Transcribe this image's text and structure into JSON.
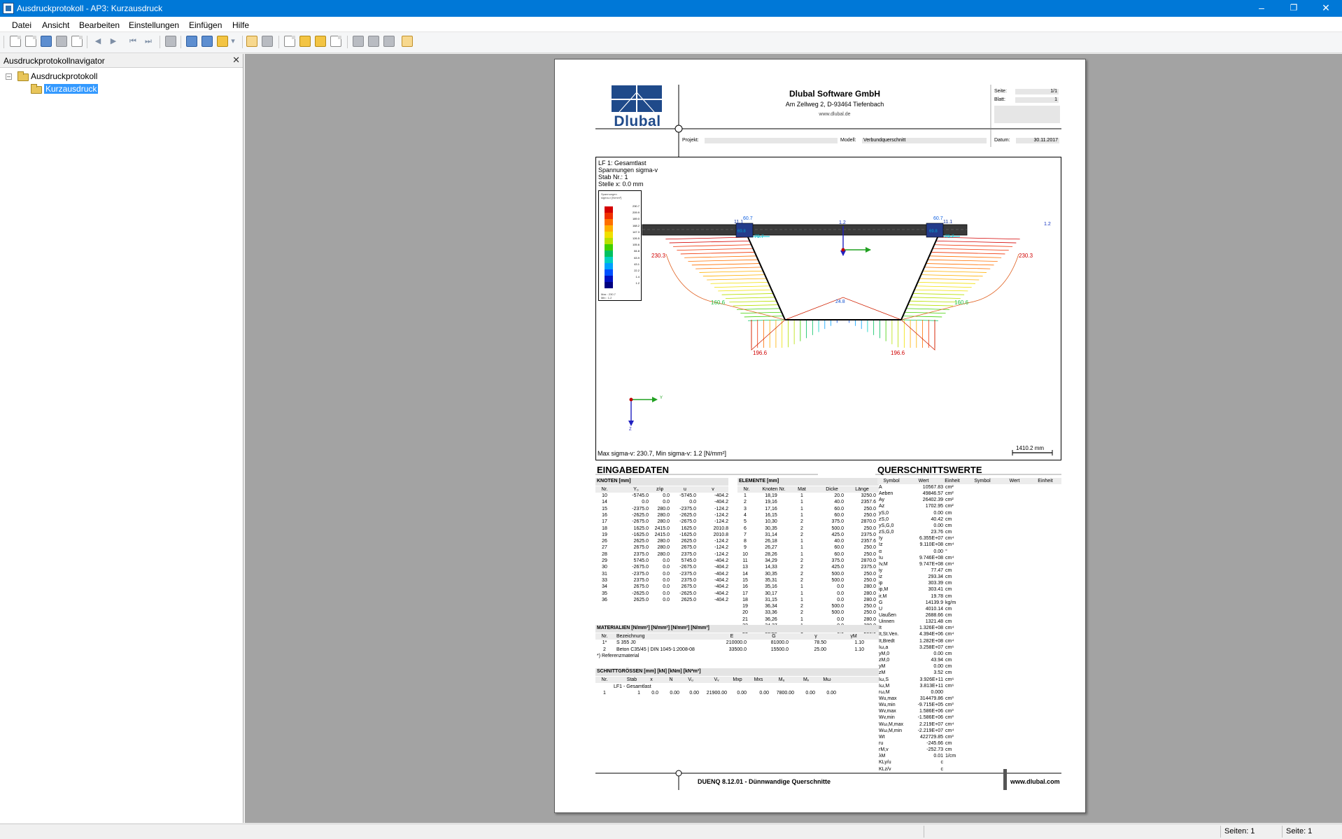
{
  "window": {
    "title": "Ausdruckprotokoll - AP3: Kurzausdruck"
  },
  "menu": [
    "Datei",
    "Ansicht",
    "Bearbeiten",
    "Einstellungen",
    "Einfügen",
    "Hilfe"
  ],
  "navigator": {
    "title": "Ausdruckprotokollnavigator",
    "root": "Ausdruckprotokoll",
    "child": "Kurzausdruck"
  },
  "status": {
    "pages_left": "Seiten: 1",
    "page_right": "Seite: 1"
  },
  "report": {
    "company": "Dlubal Software GmbH",
    "address": "Am Zellweg 2, D-93464 Tiefenbach",
    "web": "www.dlubal.de",
    "logo": "Dlubal",
    "seite_label": "Seite:",
    "seite_value": "1/1",
    "blatt_label": "Blatt:",
    "blatt_value": "1",
    "projekt_label": "Projekt:",
    "modell_label": "Modell:",
    "modell_value": "Verbundquerschnitt",
    "datum_label": "Datum:",
    "datum_value": "30.11.2017",
    "footer_program": "DUENQ 8.12.01 - Dünnwandige Querschnitte",
    "footer_web": "www.dlubal.com"
  },
  "graphic": {
    "info_lines": [
      "LF 1: Gesamtlast",
      "Spannungen sigma-v",
      "Stab Nr.: 1",
      "Stelle x: 0.0 mm"
    ],
    "legend_title": "Spannungen",
    "legend_unit": "sigma-v [N/mm²]",
    "legend_values": [
      "230.7",
      "209.9",
      "189.0",
      "168.2",
      "147.3",
      "126.5",
      "105.6",
      "84.8",
      "63.9",
      "43.1",
      "22.2",
      "1.4",
      "1.2"
    ],
    "legend_colors": [
      "#d40000",
      "#f03000",
      "#ff7000",
      "#ffb000",
      "#f0e000",
      "#b8e000",
      "#40d000",
      "#00c060",
      "#00d0c0",
      "#00a0ff",
      "#0050ff",
      "#0010c0",
      "#000080"
    ],
    "legend_max": "Max : 230.7",
    "legend_min": "Min :   1.2",
    "labels": {
      "wall_left_top": "230.3",
      "wall_right_top": "230.3",
      "wall_left_mid": "160.6",
      "wall_right_mid": "160.6",
      "bottom_center": "24.8",
      "bottom_left": "196.6",
      "bottom_right": "196.6",
      "flange_left_a": "60.7",
      "flange_left_b": "11.1",
      "flange_left_c": "79.7",
      "flange_left_d": "69.8",
      "flange_right_a": "60.7",
      "flange_right_b": "11.1",
      "flange_right_c": "79.7",
      "flange_right_d": "69.8",
      "deck_center": "1.2",
      "deck_right": "1.2"
    },
    "axis_y": "Y",
    "axis_z": "Z",
    "caption": "Max sigma-v: 230.7, Min sigma-v: 1.2 [N/mm²]",
    "scale_label": "1410.2 mm"
  },
  "eingabe": {
    "title": "EINGABEDATEN",
    "knoten_title": "KNOTEN [mm]",
    "knoten_cols": [
      "Nr.",
      "Y₀",
      "z/φ",
      "u",
      "v"
    ],
    "knoten_rows": [
      [
        "10",
        "-5745.0",
        "0.0",
        "-5745.0",
        "-404.2"
      ],
      [
        "14",
        "0.0",
        "0.0",
        "0.0",
        "-404.2"
      ],
      [
        "15",
        "-2375.0",
        "280.0",
        "-2375.0",
        "-124.2"
      ],
      [
        "16",
        "-2625.0",
        "280.0",
        "-2625.0",
        "-124.2"
      ],
      [
        "17",
        "-2675.0",
        "280.0",
        "-2675.0",
        "-124.2"
      ],
      [
        "18",
        "1625.0",
        "2415.0",
        "1625.0",
        "2010.8"
      ],
      [
        "19",
        "-1625.0",
        "2415.0",
        "-1625.0",
        "2010.8"
      ],
      [
        "26",
        "2625.0",
        "280.0",
        "2625.0",
        "-124.2"
      ],
      [
        "27",
        "2675.0",
        "280.0",
        "2675.0",
        "-124.2"
      ],
      [
        "28",
        "2375.0",
        "280.0",
        "2375.0",
        "-124.2"
      ],
      [
        "29",
        "5745.0",
        "0.0",
        "5745.0",
        "-404.2"
      ],
      [
        "30",
        "-2675.0",
        "0.0",
        "-2675.0",
        "-404.2"
      ],
      [
        "31",
        "-2375.0",
        "0.0",
        "-2375.0",
        "-404.2"
      ],
      [
        "33",
        "2375.0",
        "0.0",
        "2375.0",
        "-404.2"
      ],
      [
        "34",
        "2675.0",
        "0.0",
        "2675.0",
        "-404.2"
      ],
      [
        "35",
        "-2625.0",
        "0.0",
        "-2625.0",
        "-404.2"
      ],
      [
        "36",
        "2625.0",
        "0.0",
        "2625.0",
        "-404.2"
      ]
    ],
    "elem_title": "ELEMENTE [mm]",
    "elem_cols": [
      "Nr.",
      "Knoten Nr.",
      "Mat",
      "Dicke",
      "Länge"
    ],
    "elem_rows": [
      [
        "1",
        "18,19",
        "1",
        "20.0",
        "3250.0"
      ],
      [
        "2",
        "19,16",
        "1",
        "40.0",
        "2357.6"
      ],
      [
        "3",
        "17,16",
        "1",
        "60.0",
        "250.0"
      ],
      [
        "4",
        "16,15",
        "1",
        "60.0",
        "250.0"
      ],
      [
        "5",
        "10,30",
        "2",
        "375.0",
        "2870.0"
      ],
      [
        "6",
        "30,35",
        "2",
        "500.0",
        "250.0"
      ],
      [
        "7",
        "31,14",
        "2",
        "425.0",
        "2375.0"
      ],
      [
        "8",
        "26,18",
        "1",
        "40.0",
        "2357.6"
      ],
      [
        "9",
        "26,27",
        "1",
        "60.0",
        "250.0"
      ],
      [
        "10",
        "28,26",
        "1",
        "60.0",
        "250.0"
      ],
      [
        "11",
        "34,29",
        "2",
        "375.0",
        "2870.0"
      ],
      [
        "13",
        "14,33",
        "2",
        "425.0",
        "2375.0"
      ],
      [
        "14",
        "30,35",
        "2",
        "500.0",
        "250.0"
      ],
      [
        "15",
        "35,31",
        "2",
        "500.0",
        "250.0"
      ],
      [
        "16",
        "35,16",
        "1",
        "0.0",
        "280.0"
      ],
      [
        "17",
        "30,17",
        "1",
        "0.0",
        "280.0"
      ],
      [
        "18",
        "31,15",
        "1",
        "0.0",
        "280.0"
      ],
      [
        "19",
        "36,34",
        "2",
        "500.0",
        "250.0"
      ],
      [
        "20",
        "33,36",
        "2",
        "500.0",
        "250.0"
      ],
      [
        "21",
        "36,26",
        "1",
        "0.0",
        "280.0"
      ],
      [
        "22",
        "34,27",
        "1",
        "0.0",
        "280.0"
      ],
      [
        "23",
        "33,28",
        "1",
        "0.0",
        "280.0"
      ]
    ],
    "mat_title": "MATERIALIEN [N/mm²] [N/mm²] [N/mm²] [N/mm³]",
    "mat_cols": [
      "Nr.",
      "Bezeichnung",
      "E",
      "G",
      "γ",
      "γM"
    ],
    "mat_rows": [
      [
        "1*",
        "S 355 J0",
        "210000.0",
        "81000.0",
        "78.50",
        "1.10"
      ],
      [
        "2",
        "Beton C35/45 | DIN 1045-1:2008-08",
        "33500.0",
        "15500.0",
        "25.00",
        "1.10"
      ]
    ],
    "mat_note": "*) Referenzmaterial",
    "schnitt_title": "SCHNITTGRÖSSEN [mm] [kN] [kNm] [kN*m²]",
    "schnitt_cols": [
      "Nr.",
      "Stab",
      "x",
      "N",
      "Vᵤ",
      "Vᵥ",
      "Mxp",
      "Mxs",
      "Mᵤ",
      "Mᵥ",
      "Mω"
    ],
    "schnitt_lf": "LF1 - Gesamtlast",
    "schnitt_row": [
      "1",
      "1",
      "0.0",
      "0.00",
      "0.00",
      "21900.00",
      "0.00",
      "0.00",
      "7800.00",
      "0.00",
      "0.00"
    ]
  },
  "quer": {
    "title": "QUERSCHNITTSWERTE",
    "cols": [
      "Symbol",
      "Wert",
      "Einheit",
      "Symbol",
      "Wert",
      "Einheit"
    ],
    "rows": [
      [
        "A",
        "10567.83",
        "cm²"
      ],
      [
        "Aeben",
        "49846.57",
        "cm²"
      ],
      [
        "Ay",
        "26402.39",
        "cm²"
      ],
      [
        "Az",
        "1702.95",
        "cm²"
      ],
      [
        "yS,0",
        "0.00",
        "cm"
      ],
      [
        "zS,0",
        "40.42",
        "cm"
      ],
      [
        "yS,G,0",
        "0.00",
        "cm"
      ],
      [
        "zS,G,0",
        "23.76",
        "cm"
      ],
      [
        "Iy",
        "6.355E+07",
        "cm⁴"
      ],
      [
        "Iz",
        "9.110E+08",
        "cm⁴"
      ],
      [
        "α",
        "0.00",
        "°"
      ],
      [
        "Iu",
        "9.746E+08",
        "cm⁴"
      ],
      [
        "Iv,M",
        "9.747E+08",
        "cm⁴"
      ],
      [
        "iy",
        "77.47",
        "cm"
      ],
      [
        "iz",
        "293.34",
        "cm"
      ],
      [
        "ip",
        "303.39",
        "cm"
      ],
      [
        "ip,M",
        "303.41",
        "cm"
      ],
      [
        "ir,M",
        "19.78",
        "cm"
      ],
      [
        "G",
        "14139.9",
        "kg/m"
      ],
      [
        "U",
        "4010.14",
        "cm"
      ],
      [
        "Uaußen",
        "2688.66",
        "cm"
      ],
      [
        "Uinnen",
        "1321.48",
        "cm"
      ],
      [
        "It",
        "1.326E+08",
        "cm⁴"
      ],
      [
        "It,St.Ven.",
        "4.394E+06",
        "cm⁴"
      ],
      [
        "It,Bredt",
        "1.282E+08",
        "cm⁴"
      ],
      [
        "Iω,a",
        "3.258E+07",
        "cm⁶"
      ],
      [
        "yM,0",
        "0.00",
        "cm"
      ],
      [
        "zM,0",
        "43.94",
        "cm"
      ],
      [
        "yM",
        "0.00",
        "cm"
      ],
      [
        "zM",
        "3.52",
        "cm"
      ],
      [
        "Iω,S",
        "3.926E+11",
        "cm⁶"
      ],
      [
        "Iω,M",
        "3.813E+11",
        "cm⁶"
      ],
      [
        "rω,M",
        "0.000",
        ""
      ],
      [
        "Wu,max",
        "314479.86",
        "cm³"
      ],
      [
        "Wu,min",
        "-9.715E+05",
        "cm³"
      ],
      [
        "Wv,max",
        "1.586E+06",
        "cm³"
      ],
      [
        "Wv,min",
        "-1.586E+06",
        "cm³"
      ],
      [
        "Wω,M,max",
        "2.219E+07",
        "cm⁴"
      ],
      [
        "Wω,M,min",
        "-2.219E+07",
        "cm⁴"
      ],
      [
        "Wt",
        "422729.85",
        "cm³"
      ],
      [
        "ru",
        "-245.66",
        "cm"
      ],
      [
        "rM,v",
        "-252.73",
        "cm"
      ],
      [
        "λM",
        "0.01",
        "1/cm"
      ],
      [
        "KLy/u",
        "c",
        ""
      ],
      [
        "KLz/v",
        "c",
        ""
      ]
    ]
  }
}
